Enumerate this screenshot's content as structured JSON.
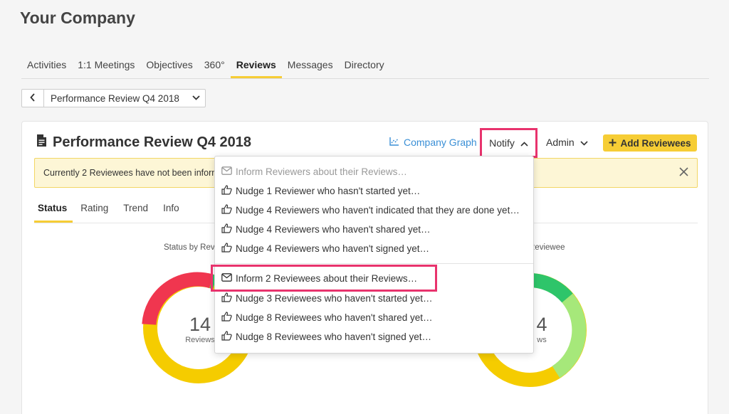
{
  "company_title": "Your Company",
  "top_nav": {
    "tabs": [
      "Activities",
      "1:1 Meetings",
      "Objectives",
      "360°",
      "Reviews",
      "Messages",
      "Directory"
    ],
    "active": "Reviews"
  },
  "review_selector": {
    "value": "Performance Review Q4 2018"
  },
  "card": {
    "title": "Performance Review Q4 2018",
    "company_graph_label": "Company Graph",
    "notify_label": "Notify",
    "admin_label": "Admin",
    "add_reviewees_label": "Add Reviewees",
    "banner_text": "Currently 2 Reviewees have not been informe",
    "sub_tabs": [
      "Status",
      "Rating",
      "Trend",
      "Info"
    ],
    "active_sub_tab": "Status",
    "left_chart": {
      "caption": "Status by Rev",
      "center_number": "14",
      "center_label": "Reviews"
    },
    "right_chart": {
      "caption": "Reviewee",
      "center_number": "4",
      "center_label": "ws"
    }
  },
  "notify_menu": {
    "reviewer_items": [
      {
        "icon": "mail-icon",
        "label": "Inform Reviewers about their Reviews…",
        "disabled": true
      },
      {
        "icon": "thumb-icon",
        "label": "Nudge 1 Reviewer who hasn't started yet…",
        "disabled": false
      },
      {
        "icon": "thumb-icon",
        "label": "Nudge 4 Reviewers who haven't indicated that they are done yet…",
        "disabled": false
      },
      {
        "icon": "thumb-icon",
        "label": "Nudge 4 Reviewers who haven't shared yet…",
        "disabled": false
      },
      {
        "icon": "thumb-icon",
        "label": "Nudge 4 Reviewers who haven't signed yet…",
        "disabled": false
      }
    ],
    "reviewee_items": [
      {
        "icon": "mail-icon",
        "label": "Inform 2 Reviewees about their Reviews…",
        "highlighted": true
      },
      {
        "icon": "thumb-icon",
        "label": "Nudge 3 Reviewees who haven't started yet…",
        "highlighted": false
      },
      {
        "icon": "thumb-icon",
        "label": "Nudge 8 Reviewees who haven't shared yet…",
        "highlighted": false
      },
      {
        "icon": "thumb-icon",
        "label": "Nudge 8 Reviewees who haven't signed yet…",
        "highlighted": false
      }
    ]
  },
  "colors": {
    "accent_yellow": "#f6cd35",
    "highlight_pink": "#e8336d",
    "link_blue": "#3a8fd6",
    "donut_red": "#f0364f",
    "donut_yellow": "#f5cc00",
    "donut_green": "#2ec56a",
    "donut_light_green": "#a6e87a"
  }
}
